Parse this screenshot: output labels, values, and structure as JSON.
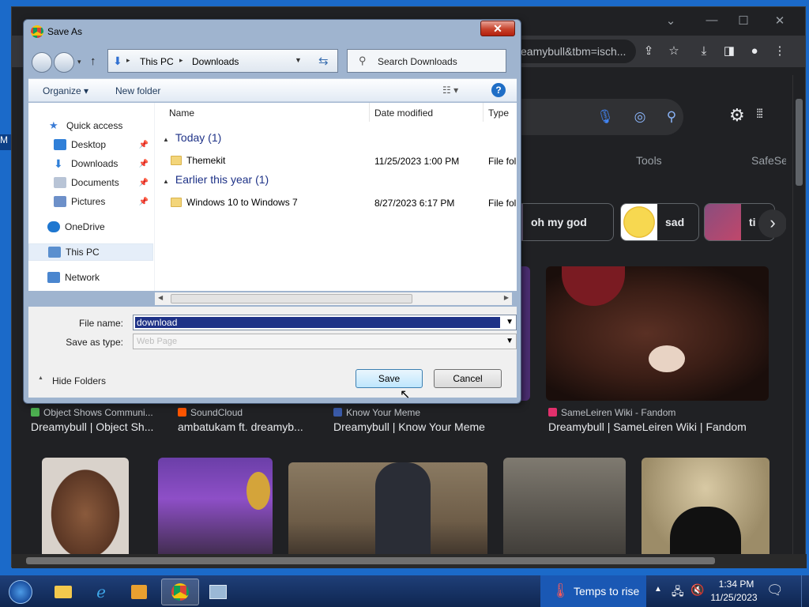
{
  "desktop": {
    "edge_letter": "M"
  },
  "browser": {
    "window_controls": [
      "⌄",
      "—",
      "☐",
      "✕"
    ],
    "address_text": "eamybull&tbm=isch...",
    "tabs_nav": [
      "Tools",
      "SafeSe"
    ],
    "chips": [
      {
        "label": "oh my god",
        "color": "#6b5f7d"
      },
      {
        "label": "sad",
        "color": "#e8c84a"
      },
      {
        "label": "ti",
        "color": "#7c5a8b"
      }
    ],
    "results": [
      {
        "source": "Object Shows Communi...",
        "title": "Dreamybull | Object Sh...",
        "icon_color": "#4caf50"
      },
      {
        "source": "SoundCloud",
        "title": "ambatukam ft. dreamyb...",
        "icon_color": "#ff5500"
      },
      {
        "source": "Know Your Meme",
        "title": "Dreamybull | Know Your Meme",
        "icon_color": "#3a5aa7"
      },
      {
        "source": "SameLeiren Wiki - Fandom",
        "title": "Dreamybull | SameLeiren Wiki | Fandom",
        "icon_color": "#e1306c"
      }
    ]
  },
  "dialog": {
    "title": "Save As",
    "breadcrumb": [
      "This PC",
      "Downloads"
    ],
    "search_placeholder": "Search Downloads",
    "organize": "Organize",
    "new_folder": "New folder",
    "sidebar": [
      {
        "label": "Quick access",
        "pinned": false,
        "color": "#3a7bd5"
      },
      {
        "label": "Desktop",
        "pinned": true,
        "color": "#2f7fd8"
      },
      {
        "label": "Downloads",
        "pinned": true,
        "color": "#2f7fd8"
      },
      {
        "label": "Documents",
        "pinned": true,
        "color": "#b8c4d6"
      },
      {
        "label": "Pictures",
        "pinned": true,
        "color": "#6d90c9"
      },
      {
        "label": "OneDrive",
        "pinned": false,
        "color": "#1f77d0"
      },
      {
        "label": "This PC",
        "pinned": false,
        "color": "#5a8fcf"
      },
      {
        "label": "Network",
        "pinned": false,
        "color": "#4a86cf"
      }
    ],
    "columns": [
      "Name",
      "Date modified",
      "Type"
    ],
    "groups": [
      {
        "label": "Today (1)",
        "items": [
          {
            "name": "Themekit",
            "date": "11/25/2023 1:00 PM",
            "type": "File fol"
          }
        ]
      },
      {
        "label": "Earlier this year (1)",
        "items": [
          {
            "name": "Windows 10 to Windows 7",
            "date": "8/27/2023 6:17 PM",
            "type": "File fol"
          }
        ]
      }
    ],
    "file_name_label": "File name:",
    "file_name_value": "download",
    "save_type_label": "Save as type:",
    "save_type_value": "Web Page",
    "hide_folders": "Hide Folders",
    "save_btn": "Save",
    "cancel_btn": "Cancel"
  },
  "taskbar": {
    "weather": "Temps to rise",
    "time": "1:34 PM",
    "date": "11/25/2023"
  }
}
